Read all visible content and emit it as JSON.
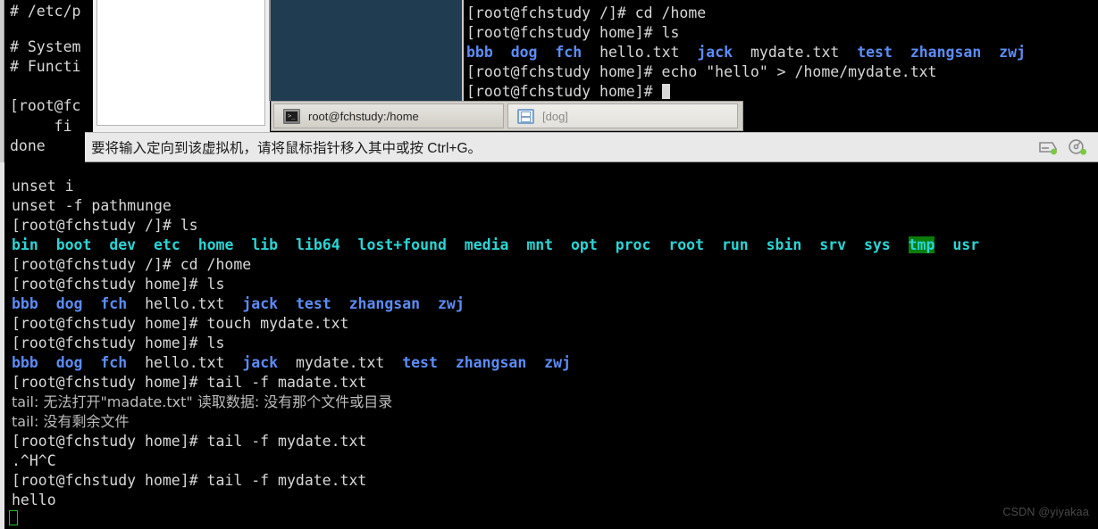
{
  "background_terminal_topleft": {
    "lines": [
      "# /etc/p",
      "",
      "# System",
      "# Functi",
      "",
      "[root@fc",
      "     fi",
      "done"
    ]
  },
  "top_right_terminal": {
    "lines": [
      "[root@fchstudy /]# cd /home",
      "[root@fchstudy home]# ls",
      "bbb  dog  fch  hello.txt  jack  mydate.txt  test  zhangsan  zwj",
      "[root@fchstudy home]# echo \"hello\" > /home/mydate.txt",
      "[root@fchstudy home]# "
    ],
    "prompt_root_home": "[root@fchstudy home]# ",
    "prompt_root_slash": "[root@fchstudy /]# ",
    "cmd_cd_home": "cd /home",
    "cmd_ls": "ls",
    "cmd_echo": "echo \"hello\" > /home/mydate.txt",
    "ls_entries": [
      {
        "name": "bbb",
        "type": "dir"
      },
      {
        "name": "dog",
        "type": "dir"
      },
      {
        "name": "fch",
        "type": "dir"
      },
      {
        "name": "hello.txt",
        "type": "file"
      },
      {
        "name": "jack",
        "type": "dir"
      },
      {
        "name": "mydate.txt",
        "type": "file"
      },
      {
        "name": "test",
        "type": "dir"
      },
      {
        "name": "zhangsan",
        "type": "dir"
      },
      {
        "name": "zwj",
        "type": "dir"
      }
    ]
  },
  "taskbar": {
    "items": [
      {
        "label": "root@fchstudy:/home",
        "icon": "terminal-icon",
        "state": "active"
      },
      {
        "label": "[dog]",
        "icon": "file-manager-icon",
        "state": "inactive"
      }
    ]
  },
  "hint_bar": {
    "message": "要将输入定向到该虚拟机，请将鼠标指针移入其中或按 Ctrl+G。",
    "tray": [
      {
        "icon": "hard-disk-icon",
        "status_color": "#7ac943"
      },
      {
        "icon": "cd-drive-icon",
        "status_color": "#7ac943"
      }
    ]
  },
  "main_terminal": {
    "prompt_slash": "[root@fchstudy /]# ",
    "prompt_home": "[root@fchstudy home]# ",
    "line_unset_i": "unset i",
    "line_unset_pathmunge": "unset -f pathmunge",
    "cmd_ls": "ls",
    "cmd_cd_home": "cd /home",
    "cmd_touch": "touch mydate.txt",
    "cmd_tail_madate": "tail -f madate.txt",
    "cmd_tail_mydate": "tail -f mydate.txt",
    "err_tail_open": "tail: 无法打开\"madate.txt\" 读取数据: 没有那个文件或目录",
    "err_tail_nofiles": "tail: 没有剩余文件",
    "ctrl_chars": ".^H^C",
    "output_hello": "hello",
    "ls_root_entries": [
      {
        "name": "bin",
        "type": "dir"
      },
      {
        "name": "boot",
        "type": "dir"
      },
      {
        "name": "dev",
        "type": "dir"
      },
      {
        "name": "etc",
        "type": "dir"
      },
      {
        "name": "home",
        "type": "dir"
      },
      {
        "name": "lib",
        "type": "dir"
      },
      {
        "name": "lib64",
        "type": "dir"
      },
      {
        "name": "lost+found",
        "type": "dir"
      },
      {
        "name": "media",
        "type": "dir"
      },
      {
        "name": "mnt",
        "type": "dir"
      },
      {
        "name": "opt",
        "type": "dir"
      },
      {
        "name": "proc",
        "type": "dir"
      },
      {
        "name": "root",
        "type": "dir"
      },
      {
        "name": "run",
        "type": "dir"
      },
      {
        "name": "sbin",
        "type": "dir"
      },
      {
        "name": "srv",
        "type": "dir"
      },
      {
        "name": "sys",
        "type": "dir"
      },
      {
        "name": "tmp",
        "type": "sticky-dir"
      },
      {
        "name": "usr",
        "type": "dir"
      }
    ],
    "ls_home_before": [
      {
        "name": "bbb",
        "type": "dir"
      },
      {
        "name": "dog",
        "type": "dir"
      },
      {
        "name": "fch",
        "type": "dir"
      },
      {
        "name": "hello.txt",
        "type": "file"
      },
      {
        "name": "jack",
        "type": "dir"
      },
      {
        "name": "test",
        "type": "dir"
      },
      {
        "name": "zhangsan",
        "type": "dir"
      },
      {
        "name": "zwj",
        "type": "dir"
      }
    ],
    "ls_home_after": [
      {
        "name": "bbb",
        "type": "dir"
      },
      {
        "name": "dog",
        "type": "dir"
      },
      {
        "name": "fch",
        "type": "dir"
      },
      {
        "name": "hello.txt",
        "type": "file"
      },
      {
        "name": "jack",
        "type": "dir"
      },
      {
        "name": "mydate.txt",
        "type": "file"
      },
      {
        "name": "test",
        "type": "dir"
      },
      {
        "name": "zhangsan",
        "type": "dir"
      },
      {
        "name": "zwj",
        "type": "dir"
      }
    ]
  },
  "watermark": {
    "text": "CSDN @yiyakaa"
  },
  "colors": {
    "terminal_bg": "#000000",
    "dir_blue": "#5c8cf5",
    "dir_cyan": "#2ad4d4",
    "sticky_bg": "#0a7d0a",
    "text": "#d8d8d8",
    "panel_blue": "#1f3c50",
    "taskbar_bg": "#d4d0c8",
    "cursor_green": "#21c421"
  }
}
